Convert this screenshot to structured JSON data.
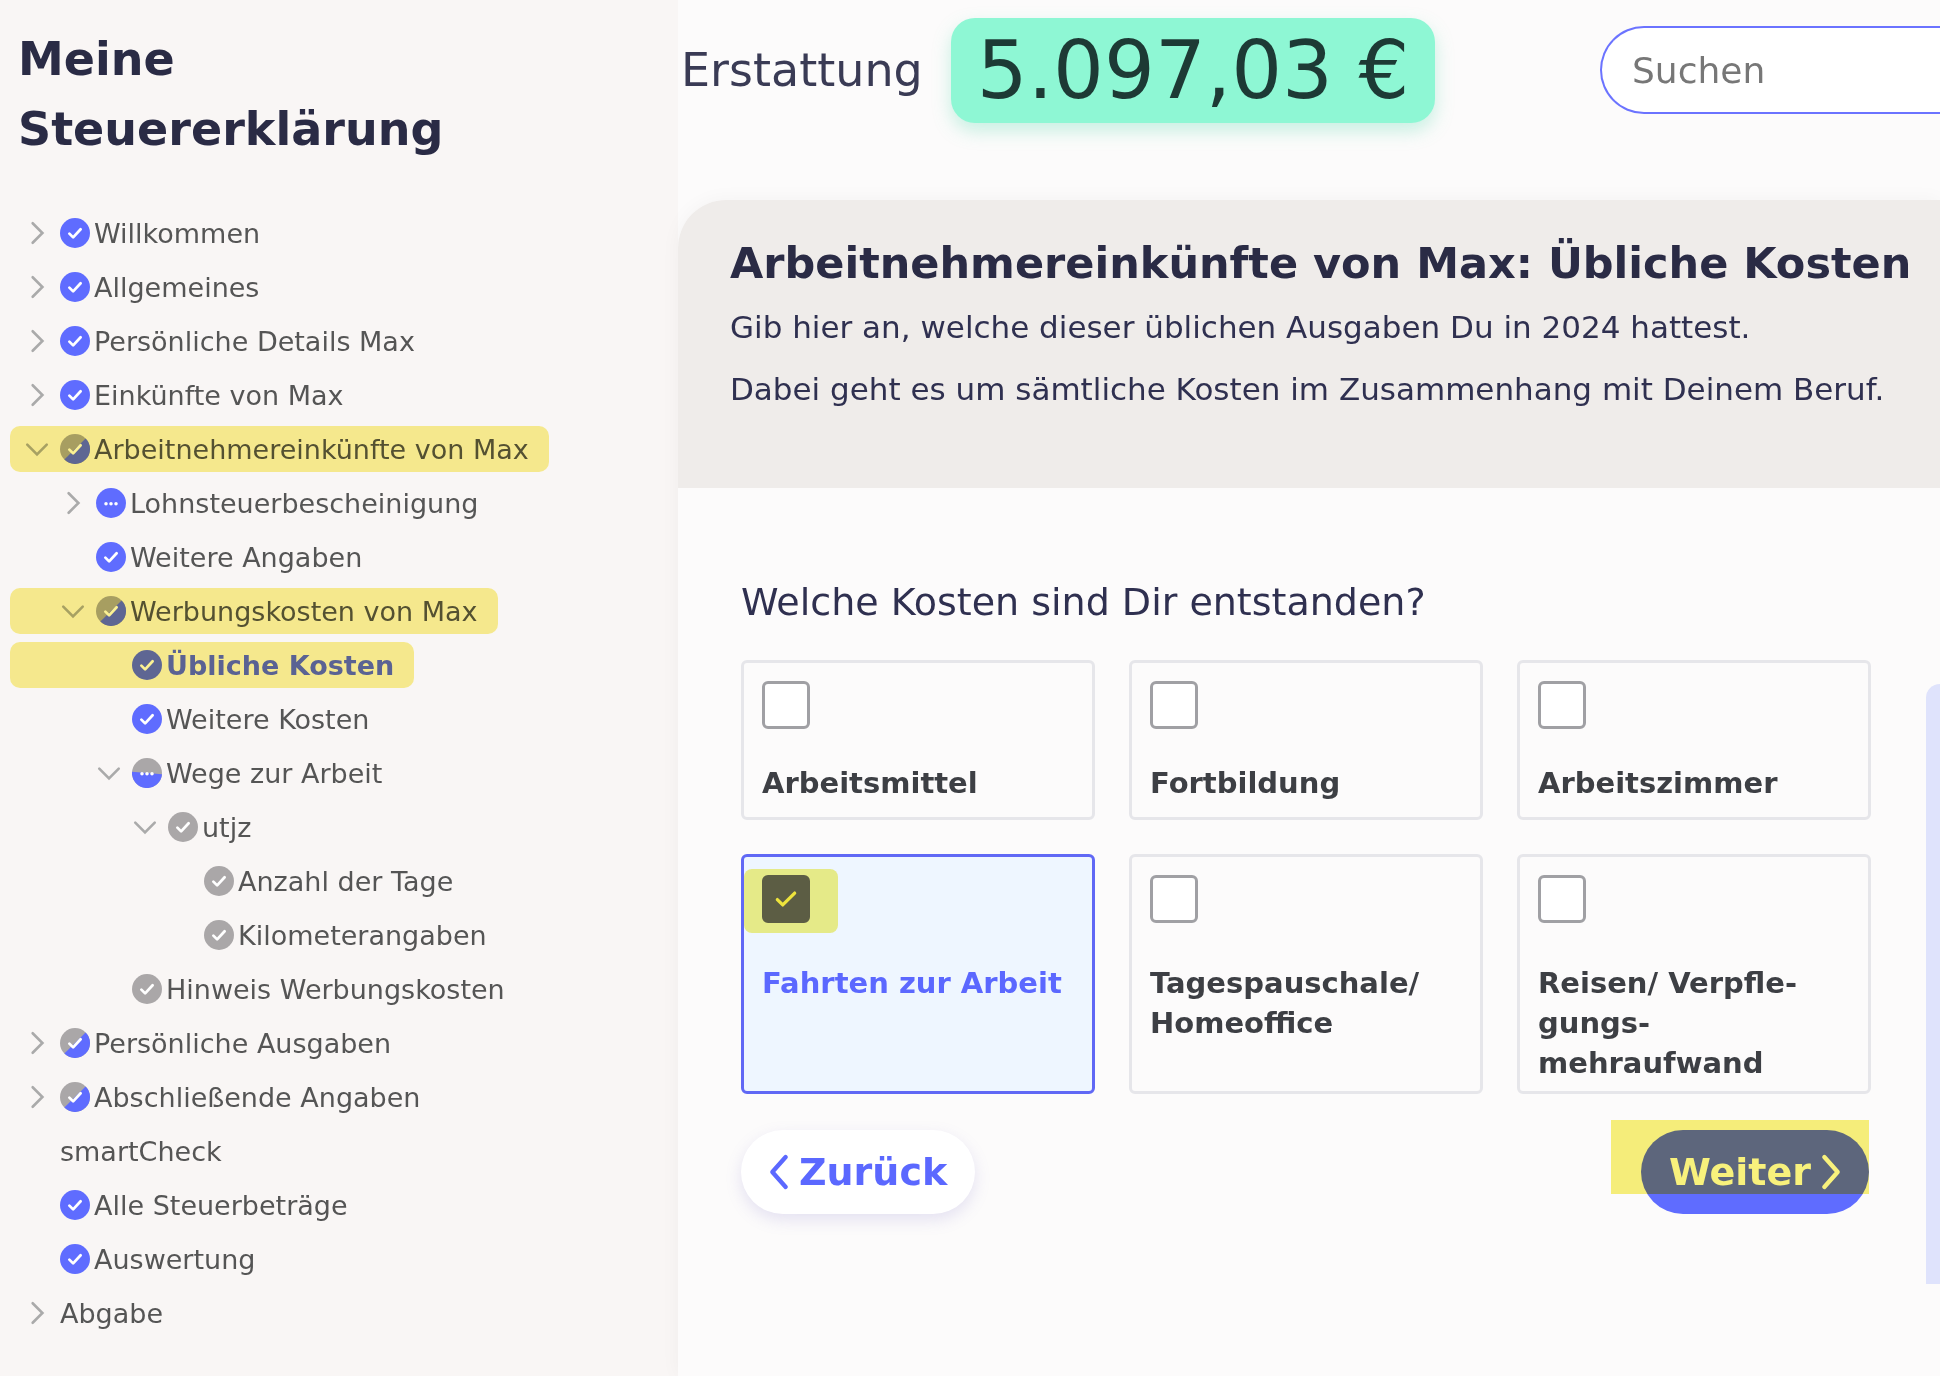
{
  "sidebar": {
    "title": "Meine Steuererklärung",
    "tree": [
      {
        "label": "Willkommen",
        "kind": "done",
        "expanded": false,
        "selected": false
      },
      {
        "label": "Allgemeines",
        "kind": "done",
        "expanded": false,
        "selected": false
      },
      {
        "label": "Persönliche Details Max",
        "kind": "done",
        "expanded": false,
        "selected": false
      },
      {
        "label": "Einkünfte von Max",
        "kind": "done",
        "expanded": false,
        "selected": false
      },
      {
        "label": "Arbeitnehmereinkünfte von Max",
        "kind": "mixed",
        "expanded": true,
        "highlighted": true,
        "selected": false,
        "children": [
          {
            "label": "Lohnsteuerbescheinigung",
            "kind": "open",
            "expanded": false,
            "selected": false
          },
          {
            "label": "Weitere Angaben",
            "kind": "done",
            "selected": false
          },
          {
            "label": "Werbungskosten von Max",
            "kind": "mixed",
            "expanded": true,
            "highlighted": true,
            "selected": false,
            "children": [
              {
                "label": "Übliche Kosten",
                "kind": "done",
                "selected": true,
                "highlighted": true
              },
              {
                "label": "Weitere Kosten",
                "kind": "done",
                "selected": false
              },
              {
                "label": "Wege zur Arbeit",
                "kind": "halfopen",
                "expanded": true,
                "selected": false,
                "children": [
                  {
                    "label": "utjz",
                    "kind": "pending",
                    "expanded": true,
                    "selected": false,
                    "children": [
                      {
                        "label": "Anzahl der Tage",
                        "kind": "pending",
                        "selected": false
                      },
                      {
                        "label": "Kilometerangaben",
                        "kind": "pending",
                        "selected": false
                      }
                    ]
                  }
                ]
              },
              {
                "label": "Hinweis Werbungskosten",
                "kind": "pending",
                "selected": false
              }
            ]
          }
        ]
      },
      {
        "label": "Persönliche Ausgaben",
        "kind": "mixed",
        "expanded": false,
        "selected": false
      },
      {
        "label": "Abschließende Angaben",
        "kind": "mixed",
        "expanded": false,
        "selected": false
      },
      {
        "label": "smartCheck",
        "kind": "plain",
        "selected": false
      },
      {
        "label": "Alle Steuerbeträge",
        "kind": "done",
        "selected": false
      },
      {
        "label": "Auswertung",
        "kind": "done",
        "selected": false
      },
      {
        "label": "Abgabe",
        "kind": "plain",
        "expanded": false,
        "selected": false
      }
    ]
  },
  "header": {
    "refund_label": "Erstattung",
    "refund_amount": "5.097,03 €",
    "search": {
      "placeholder": "Suchen"
    }
  },
  "main": {
    "title": "Arbeitnehmereinkünfte von Max: Übliche Kosten",
    "intro": [
      "Gib hier an, welche dieser üblichen Ausgaben Du in 2024 hattest.",
      "Dabei geht es um sämtliche Kosten im Zusammenhang mit Deinem Beruf."
    ],
    "question": "Welche Kosten sind Dir entstanden?",
    "options": [
      {
        "label": "Arbeitsmittel",
        "checked": false
      },
      {
        "label": "Fortbildung",
        "checked": false
      },
      {
        "label": "Arbeitszimmer",
        "checked": false
      },
      {
        "label": "Fahrten zur Arbeit",
        "checked": true,
        "highlighted": true
      },
      {
        "label": "Tagespauschale/ Homeoffice",
        "checked": false
      },
      {
        "label": "Reisen/ Verpfle-gungs-mehraufwand",
        "checked": false
      }
    ],
    "back_button": {
      "label": "Zurück"
    },
    "next_button": {
      "label": "Weiter",
      "highlighted": true
    }
  }
}
